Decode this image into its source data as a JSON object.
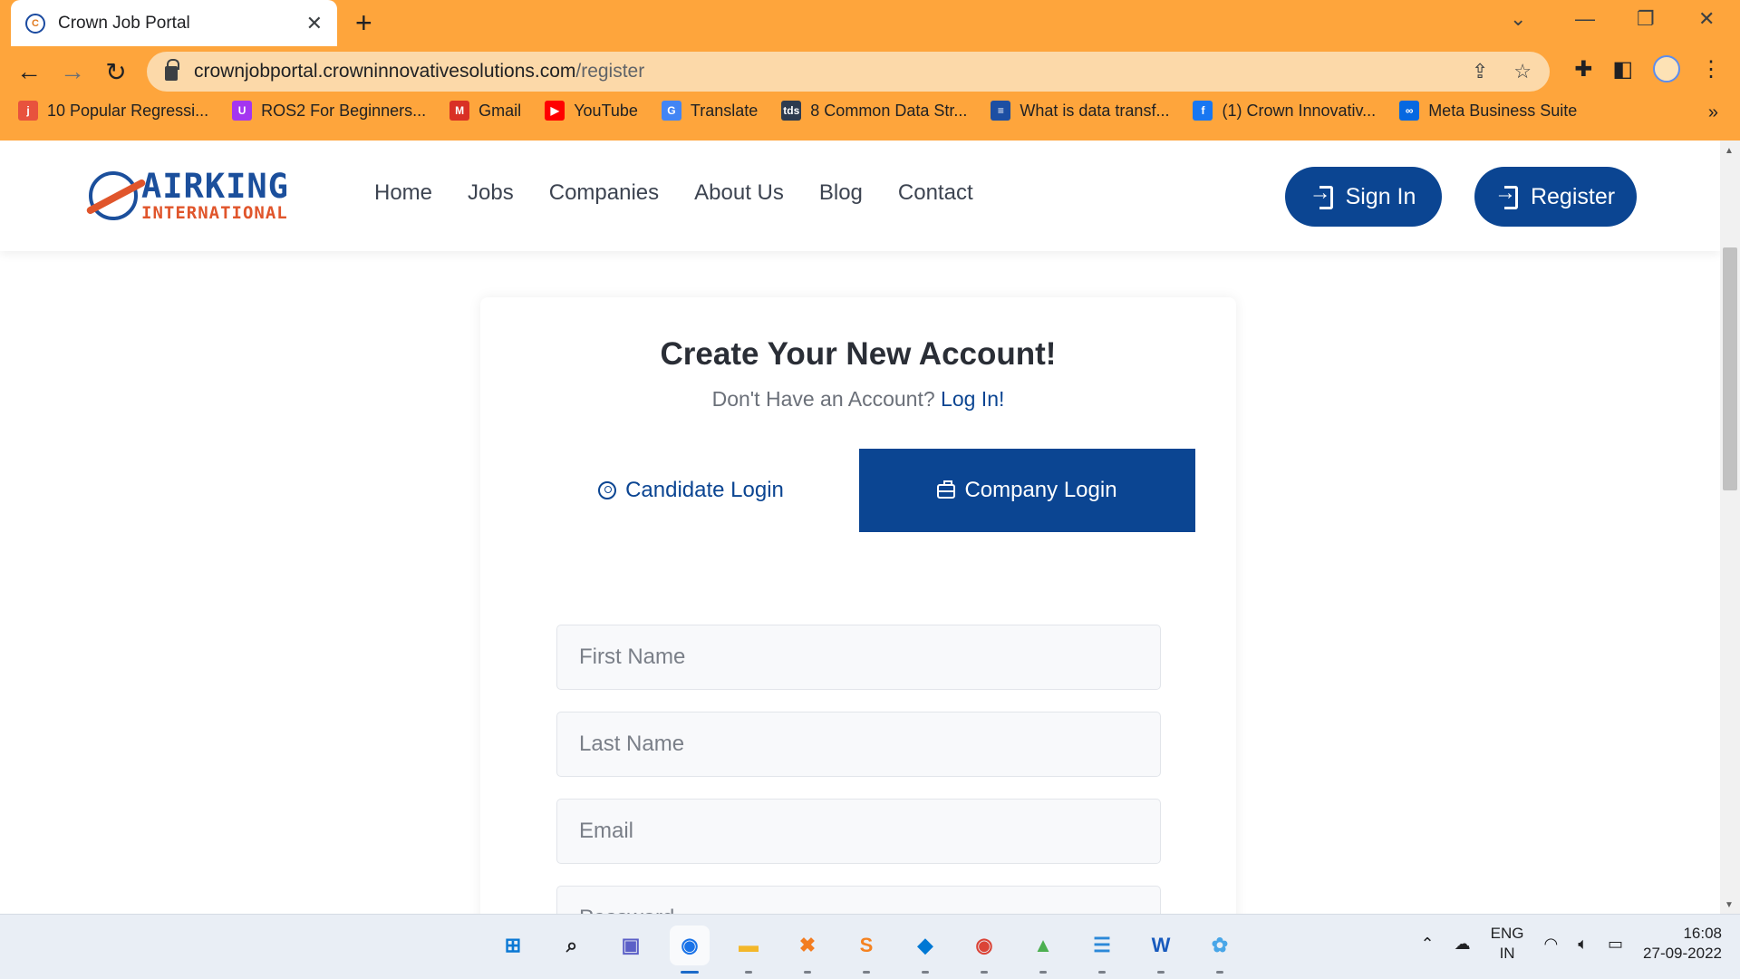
{
  "browser": {
    "tab_title": "Crown Job Portal",
    "url_host": "crownjobportal.crowninnovativesolutions.com",
    "url_path": "/register",
    "bookmarks": [
      {
        "label": "10 Popular Regressi...",
        "icon": "j",
        "color": "#e8523d"
      },
      {
        "label": "ROS2 For Beginners...",
        "icon": "U",
        "color": "#a435f0"
      },
      {
        "label": "Gmail",
        "icon": "M",
        "color": "#d93025"
      },
      {
        "label": "YouTube",
        "icon": "▶",
        "color": "#ff0000"
      },
      {
        "label": "Translate",
        "icon": "G",
        "color": "#4285f4"
      },
      {
        "label": "8 Common Data Str...",
        "icon": "tds",
        "color": "#2d3b4f"
      },
      {
        "label": "What is data transf...",
        "icon": "≡",
        "color": "#1d4fa3"
      },
      {
        "label": "(1) Crown Innovativ...",
        "icon": "f",
        "color": "#1877f2"
      },
      {
        "label": "Meta Business Suite",
        "icon": "∞",
        "color": "#0668e1"
      }
    ]
  },
  "site": {
    "logo_top": "AIRKING",
    "logo_bottom": "INTERNATIONAL",
    "nav": [
      "Home",
      "Jobs",
      "Companies",
      "About Us",
      "Blog",
      "Contact"
    ],
    "sign_in": "Sign In",
    "register": "Register"
  },
  "form": {
    "title": "Create Your New Account!",
    "subtitle": "Don't Have an Account?",
    "login_link": "Log In!",
    "tab_candidate": "Candidate Login",
    "tab_company": "Company Login",
    "active_tab": "company",
    "first_name_placeholder": "First Name",
    "last_name_placeholder": "Last Name",
    "email_placeholder": "Email",
    "password_placeholder": "Password"
  },
  "taskbar": {
    "apps": [
      {
        "name": "windows-start",
        "glyph": "⊞",
        "color": "#0a78d4"
      },
      {
        "name": "search",
        "glyph": "⌕",
        "color": "#202124"
      },
      {
        "name": "teams-chat",
        "glyph": "▣",
        "color": "#5b5fc7"
      },
      {
        "name": "chrome",
        "glyph": "◉",
        "color": "#1a73e8",
        "active": true
      },
      {
        "name": "file-explorer",
        "glyph": "▬",
        "color": "#f3b72a"
      },
      {
        "name": "xampp",
        "glyph": "✖",
        "color": "#f37c20"
      },
      {
        "name": "sublime-text",
        "glyph": "S",
        "color": "#f58220"
      },
      {
        "name": "vscode",
        "glyph": "◆",
        "color": "#0078d4"
      },
      {
        "name": "chrome-alt",
        "glyph": "◉",
        "color": "#db4437"
      },
      {
        "name": "image-editor",
        "glyph": "▲",
        "color": "#4caf50"
      },
      {
        "name": "notepad",
        "glyph": "☰",
        "color": "#2b88d8"
      },
      {
        "name": "word",
        "glyph": "W",
        "color": "#185abd"
      },
      {
        "name": "paint",
        "glyph": "✿",
        "color": "#49a6e8"
      }
    ],
    "lang_top": "ENG",
    "lang_bottom": "IN",
    "time": "16:08",
    "date": "27-09-2022"
  }
}
